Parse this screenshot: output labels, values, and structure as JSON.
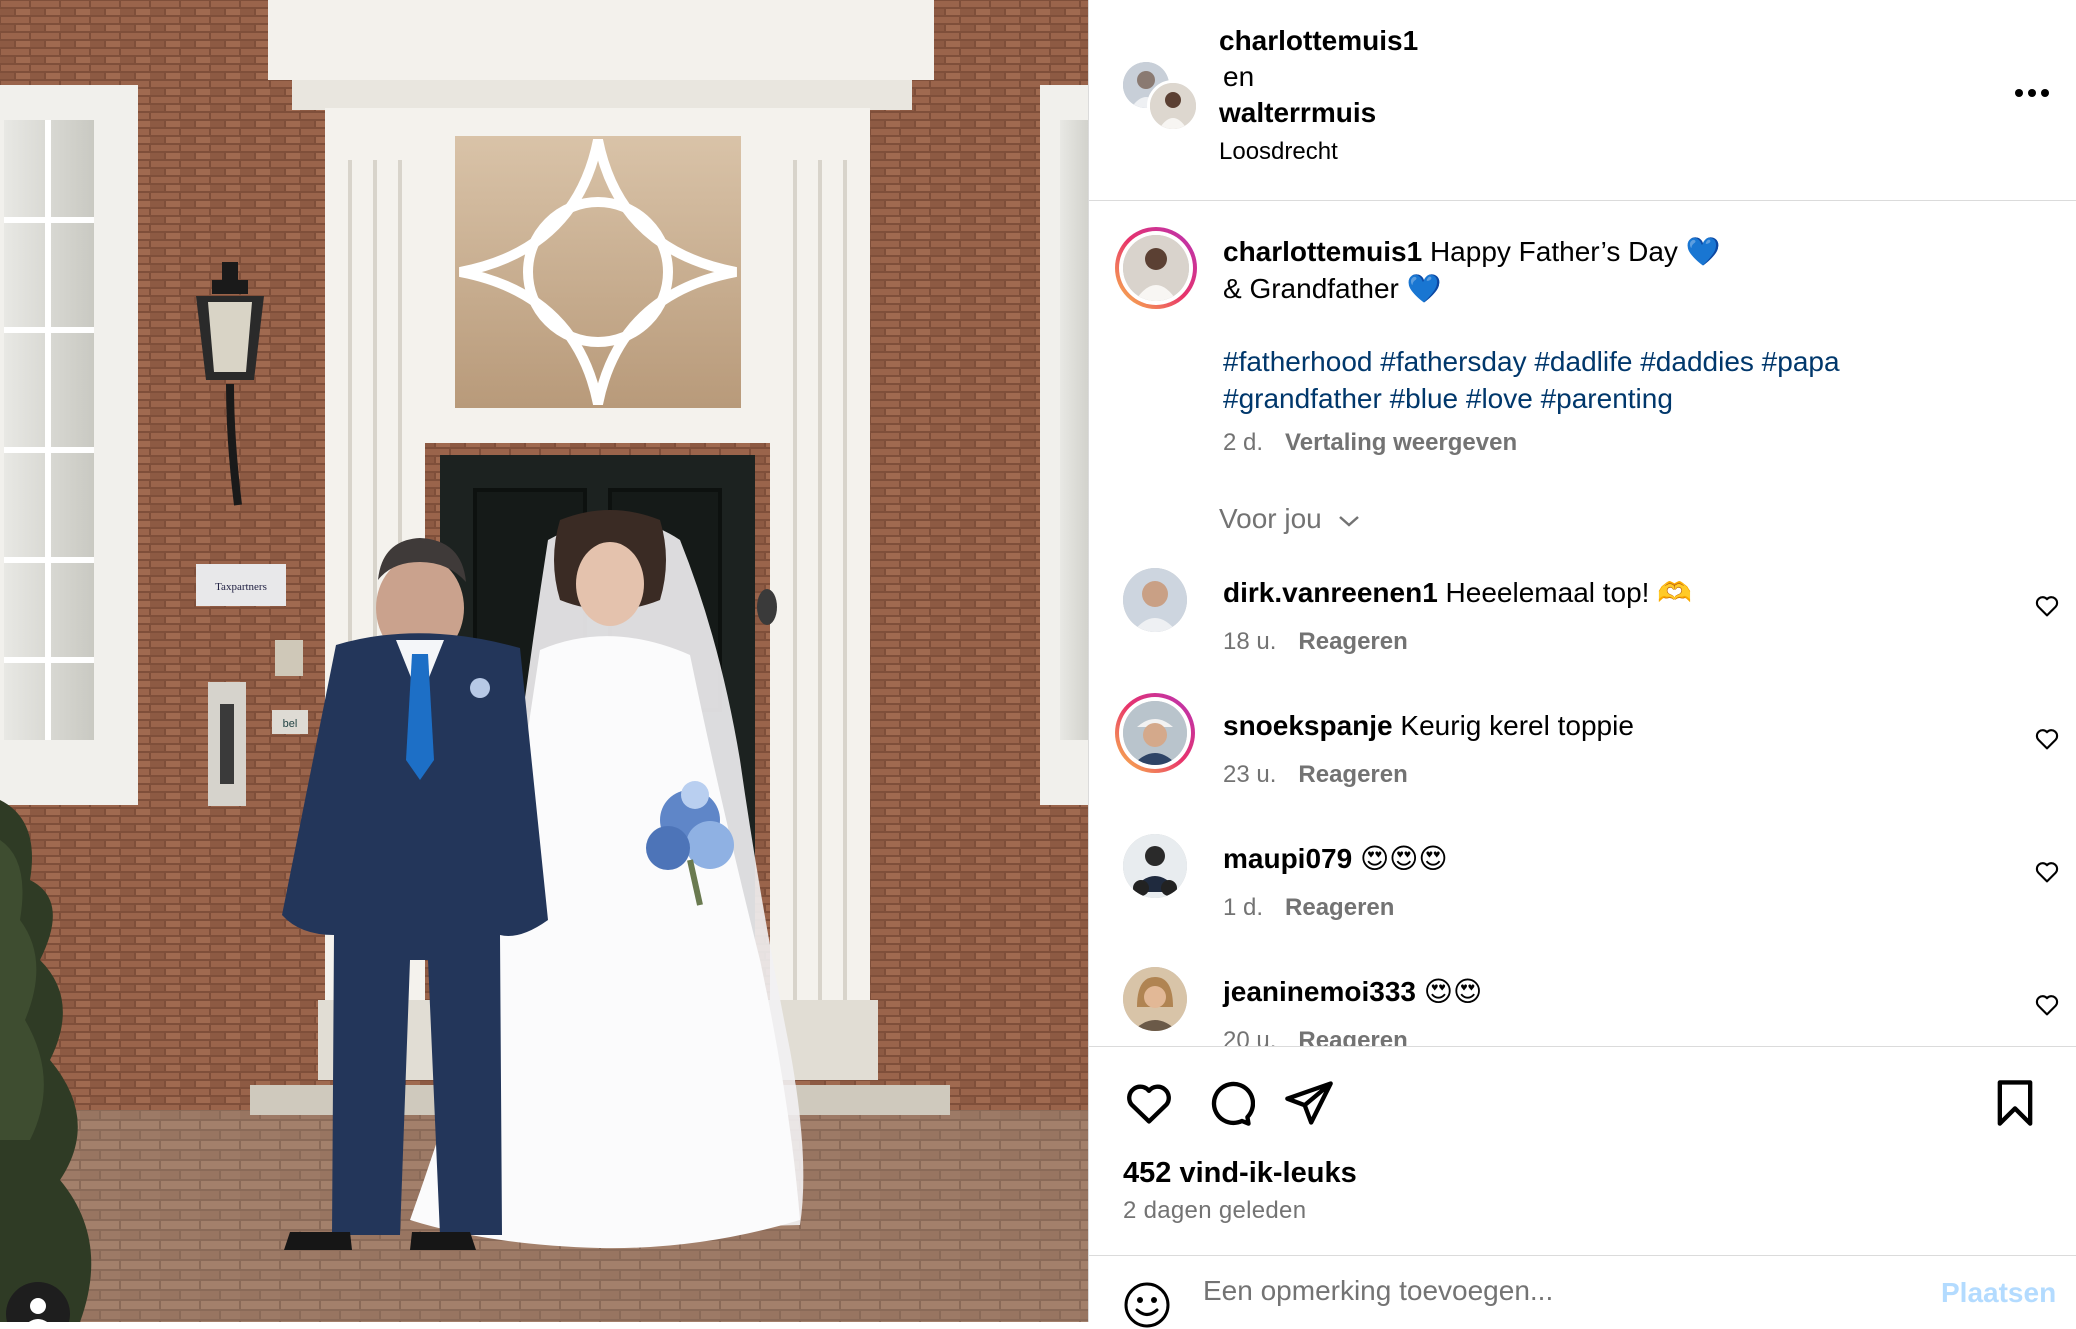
{
  "post": {
    "header": {
      "author": "charlottemuis1",
      "joiner": "en",
      "coauthor": "walterrmuis",
      "location": "Loosdrecht",
      "more_icon": "more-horizontal-icon"
    },
    "caption": {
      "username": "charlottemuis1",
      "line1": " Happy Father’s Day 💙",
      "line2": "& Grandfather 💙",
      "hashtags_line1": [
        "#fatherhood",
        "#fathersday",
        "#dadlife",
        "#daddies",
        "#papa"
      ],
      "hashtags_line2": [
        "#grandfather",
        "#blue",
        "#love",
        "#parenting"
      ],
      "age": "2 d.",
      "translate": "Vertaling weergeven"
    },
    "filter": {
      "label": "Voor jou",
      "icon": "chevron-down-icon"
    },
    "comments": [
      {
        "username": "dirk.vanreenen1",
        "text": " Heeelemaal top! 🫶",
        "age": "18 u.",
        "reply": "Reageren"
      },
      {
        "username": "snoekspanje",
        "text": " Keurig kerel toppie",
        "age": "23 u.",
        "reply": "Reageren"
      },
      {
        "username": "maupi079",
        "text": " 😍😍😍",
        "age": "1 d.",
        "reply": "Reageren"
      },
      {
        "username": "jeaninemoi333",
        "text": " 😍😍",
        "age": "20 u.",
        "reply": "Reageren"
      }
    ],
    "actions": {
      "like_icon": "heart-icon",
      "comment_icon": "comment-icon",
      "share_icon": "send-icon",
      "save_icon": "bookmark-icon"
    },
    "likes": "452 vind-ik-leuks",
    "date": "2 dagen geleden",
    "add_comment": {
      "emoji_icon": "emoji-icon",
      "placeholder": "Een opmerking toevoegen...",
      "post_label": "Plaatsen"
    }
  },
  "photo": {
    "sign_text": "Taxpartners",
    "bell_text": "bel",
    "user_tag_icon": "user-tag-icon"
  },
  "colors": {
    "hashtag": "#00376b",
    "muted": "#737373",
    "post_button_disabled": "#b3dbff",
    "border": "#dbdbdb"
  }
}
